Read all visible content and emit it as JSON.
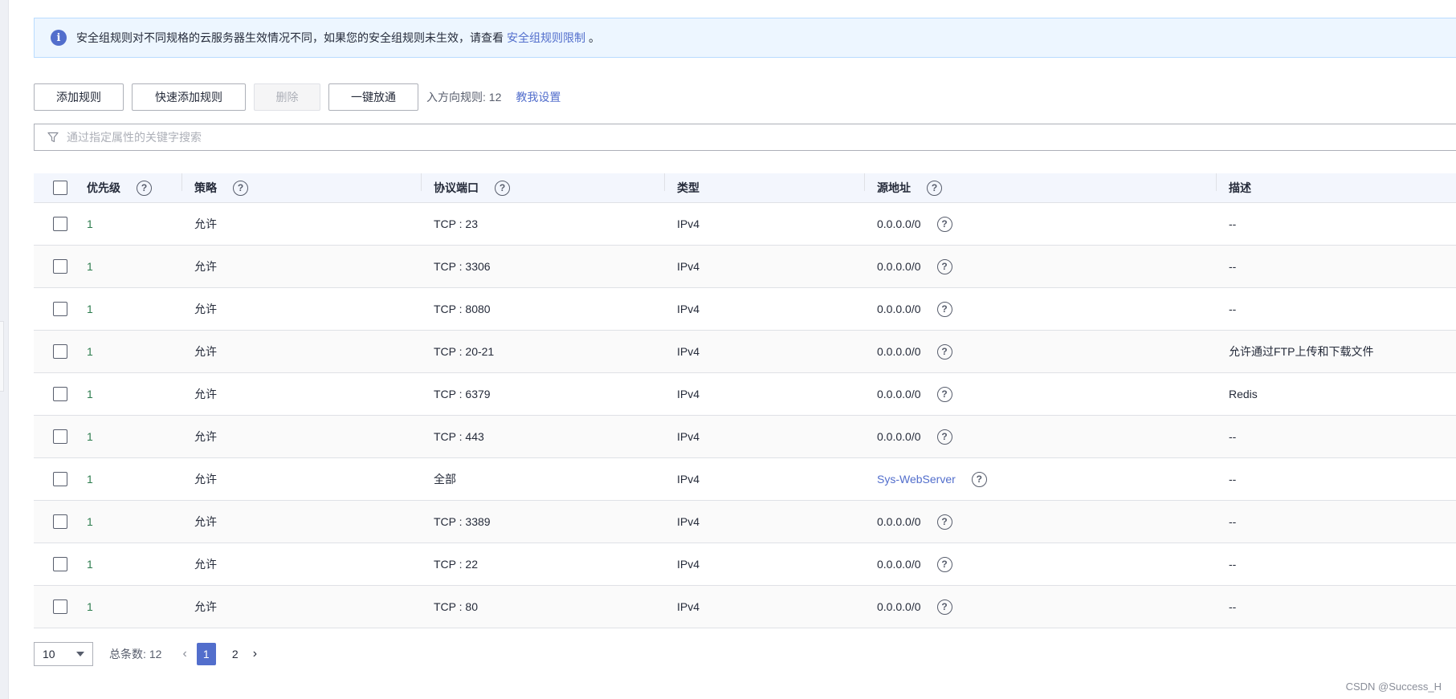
{
  "notice": {
    "text": "安全组规则对不同规格的云服务器生效情况不同，如果您的安全组规则未生效，请查看",
    "link": "安全组规则限制",
    "suffix": "。"
  },
  "toolbar": {
    "add_rule": "添加规则",
    "quick_add_rule": "快速添加规则",
    "delete": "删除",
    "one_click_allow": "一键放通",
    "inbound_count_label": "入方向规则: 12",
    "help_link": "教我设置"
  },
  "search": {
    "placeholder": "通过指定属性的关键字搜索"
  },
  "table": {
    "headers": {
      "priority": "优先级",
      "policy": "策略",
      "protocol_port": "协议端口",
      "type": "类型",
      "source": "源地址",
      "description": "描述"
    },
    "rows": [
      {
        "priority": "1",
        "policy": "允许",
        "protocol_port": "TCP : 23",
        "type": "IPv4",
        "source": "0.0.0.0/0",
        "description": "--"
      },
      {
        "priority": "1",
        "policy": "允许",
        "protocol_port": "TCP : 3306",
        "type": "IPv4",
        "source": "0.0.0.0/0",
        "description": "--"
      },
      {
        "priority": "1",
        "policy": "允许",
        "protocol_port": "TCP : 8080",
        "type": "IPv4",
        "source": "0.0.0.0/0",
        "description": "--"
      },
      {
        "priority": "1",
        "policy": "允许",
        "protocol_port": "TCP : 20-21",
        "type": "IPv4",
        "source": "0.0.0.0/0",
        "description": "允许通过FTP上传和下载文件"
      },
      {
        "priority": "1",
        "policy": "允许",
        "protocol_port": "TCP : 6379",
        "type": "IPv4",
        "source": "0.0.0.0/0",
        "description": "Redis"
      },
      {
        "priority": "1",
        "policy": "允许",
        "protocol_port": "TCP : 443",
        "type": "IPv4",
        "source": "0.0.0.0/0",
        "description": "--"
      },
      {
        "priority": "1",
        "policy": "允许",
        "protocol_port": "全部",
        "type": "IPv4",
        "source": "Sys-WebServer",
        "description": "--"
      },
      {
        "priority": "1",
        "policy": "允许",
        "protocol_port": "TCP : 3389",
        "type": "IPv4",
        "source": "0.0.0.0/0",
        "description": "--"
      },
      {
        "priority": "1",
        "policy": "允许",
        "protocol_port": "TCP : 22",
        "type": "IPv4",
        "source": "0.0.0.0/0",
        "description": "--"
      },
      {
        "priority": "1",
        "policy": "允许",
        "protocol_port": "TCP : 80",
        "type": "IPv4",
        "source": "0.0.0.0/0",
        "description": "--"
      }
    ]
  },
  "pagination": {
    "page_size": "10",
    "total_label": "总条数:",
    "total": "12",
    "pages": [
      "1",
      "2"
    ],
    "current_page": "1"
  },
  "icons": {
    "info": "info-icon",
    "help": "question-circle-icon",
    "filter": "filter-icon",
    "prev": "chevron-left-icon",
    "next": "chevron-right-icon",
    "dropdown": "caret-down-icon"
  },
  "colors": {
    "accent": "#526ecc",
    "notice_bg": "#edf6ff",
    "header_bg": "#f3f6fd",
    "priority_text": "#2e7d4f"
  },
  "watermark": "CSDN @Success_H"
}
